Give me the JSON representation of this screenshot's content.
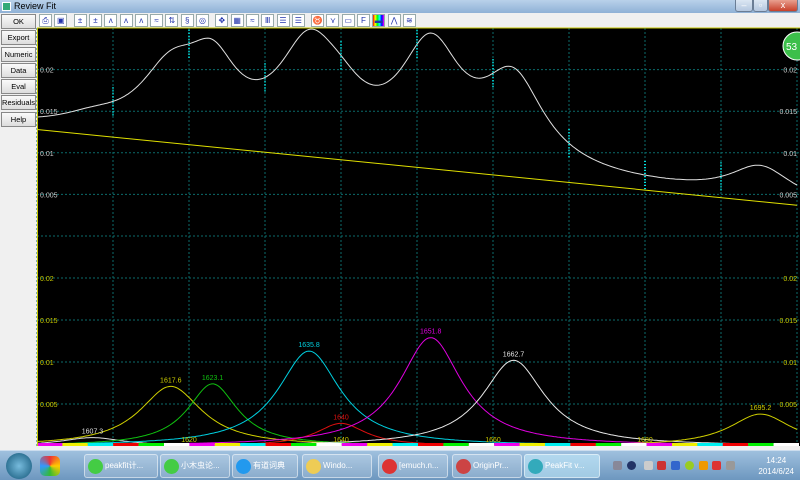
{
  "window": {
    "title": "Review Fit",
    "controls": [
      "minimize",
      "restore",
      "close"
    ]
  },
  "toolbar": {
    "icons": [
      "print-icon",
      "clipboard-icon",
      "add-peak-icon",
      "baseline-icon",
      "peak-small-icon",
      "peak-icon",
      "peak-selected-icon",
      "peak-wide-icon",
      "arrows-vertical-icon",
      "shape-icon",
      "rotate-icon",
      "move-icon",
      "grid-icon",
      "peaks-toggle-icon",
      "bars-icon",
      "list-icon",
      "list2-icon",
      "binoculars-icon",
      "scatter-icon",
      "monitor-icon",
      "font-icon",
      "color-spectrum-icon",
      "residual-icon",
      "multi-graph-icon"
    ]
  },
  "sidebar": {
    "buttons": [
      "OK",
      "Export",
      "Numeric",
      "Data",
      "Eval",
      "Residuals",
      "Help"
    ]
  },
  "badge": "53",
  "colors": {
    "grid": "#0b6b6b",
    "axis": "#c8c800",
    "fit": "#e0e0e0",
    "baseline": "#e0e000",
    "data": "#00e0e0"
  },
  "chart_data": [
    {
      "type": "line",
      "panel": "fit",
      "xlim": [
        1600,
        1700
      ],
      "ylim": [
        0,
        0.025
      ],
      "grid": true,
      "yticks": [
        "0.02",
        "0.015",
        "0.01",
        "0.005"
      ],
      "baseline": {
        "x": [
          1600,
          1700
        ],
        "y": [
          0.0128,
          0.0037
        ]
      },
      "data_x": [
        1600,
        1610,
        1620,
        1630,
        1640,
        1650,
        1660,
        1670,
        1680,
        1690
      ]
    },
    {
      "type": "line",
      "panel": "peaks",
      "xlim": [
        1600,
        1700
      ],
      "ylim": [
        0,
        0.025
      ],
      "grid": true,
      "xticks": [
        "1620",
        "1640",
        "1660",
        "1680"
      ],
      "yticks": [
        "0.02",
        "0.015",
        "0.01",
        "0.005"
      ],
      "peaks": [
        {
          "label": "1607.3",
          "center": 1607.3,
          "amplitude": 0.001,
          "hwhm": 5,
          "color": "#e0e0e0"
        },
        {
          "label": "1617.6",
          "center": 1617.6,
          "amplitude": 0.0071,
          "hwhm": 5,
          "color": "#d0d000"
        },
        {
          "label": "1623.1",
          "center": 1623.1,
          "amplitude": 0.0074,
          "hwhm": 4,
          "color": "#10c010"
        },
        {
          "label": "1635.8",
          "center": 1635.8,
          "amplitude": 0.0113,
          "hwhm": 5,
          "color": "#00d0e0"
        },
        {
          "label": "1640",
          "center": 1640,
          "amplitude": 0.0027,
          "hwhm": 4,
          "color": "#e01010"
        },
        {
          "label": "1651.8",
          "center": 1651.8,
          "amplitude": 0.0129,
          "hwhm": 5,
          "color": "#e000e0"
        },
        {
          "label": "1662.7",
          "center": 1662.7,
          "amplitude": 0.0102,
          "hwhm": 5,
          "color": "#e8e8e8"
        },
        {
          "label": "1695.2",
          "center": 1695.2,
          "amplitude": 0.0038,
          "hwhm": 5,
          "color": "#d0d000"
        }
      ]
    }
  ],
  "taskbar": {
    "items": [
      "peakfit计...",
      "小木虫论...",
      "有道词典",
      "Windo...",
      "[emuch.n...",
      "OriginPr...",
      "PeakFit v..."
    ],
    "time": "14:24",
    "date": "2014/6/24"
  }
}
